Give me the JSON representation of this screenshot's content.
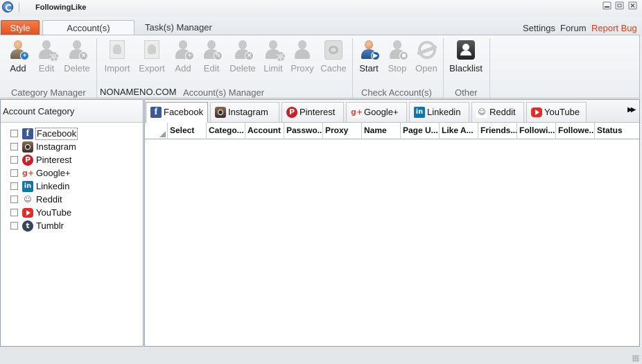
{
  "window": {
    "title": "FollowingLike",
    "controls": [
      "minimize",
      "maximize",
      "close"
    ]
  },
  "menu": {
    "style_tab": "Style",
    "tabs": [
      {
        "label": "Account(s) Manager",
        "active": true
      },
      {
        "label": "Task(s) Manager",
        "active": false
      }
    ],
    "links": {
      "settings": "Settings",
      "forum": "Forum",
      "report_bug": "Report Bug"
    },
    "report_bug_color": "#d8401b",
    "style_tab_color": "#e0501e"
  },
  "ribbon": {
    "category_manager": {
      "buttons": [
        {
          "label": "Add",
          "icon": "add-category-icon",
          "enabled": true
        },
        {
          "label": "Edit",
          "icon": "edit-category-icon",
          "enabled": false
        },
        {
          "label": "Delete",
          "icon": "delete-category-icon",
          "enabled": false
        }
      ],
      "group_label": "Category Manager"
    },
    "account_manager": {
      "buttons": [
        {
          "label": "Import",
          "icon": "import-icon",
          "enabled": false
        },
        {
          "label": "Export",
          "icon": "export-icon",
          "enabled": false
        },
        {
          "label": "Add",
          "icon": "add-account-icon",
          "enabled": false
        },
        {
          "label": "Edit",
          "icon": "edit-account-icon",
          "enabled": false
        },
        {
          "label": "Delete",
          "icon": "delete-account-icon",
          "enabled": false
        },
        {
          "label": "Limit",
          "icon": "limit-icon",
          "enabled": false
        },
        {
          "label": "Proxy",
          "icon": "proxy-icon",
          "enabled": false
        },
        {
          "label": "Cache",
          "icon": "cache-icon",
          "enabled": false
        }
      ],
      "watermark": "NONAMENO.COM",
      "group_label": "Account(s) Manager"
    },
    "check_accounts": {
      "buttons": [
        {
          "label": "Start",
          "icon": "start-check-icon",
          "enabled": true
        },
        {
          "label": "Stop",
          "icon": "stop-check-icon",
          "enabled": false
        },
        {
          "label": "Open",
          "icon": "browser-open-icon",
          "enabled": false
        }
      ],
      "group_label": "Check Account(s)"
    },
    "other": {
      "buttons": [
        {
          "label": "Blacklist",
          "icon": "blacklist-icon",
          "enabled": true
        }
      ],
      "group_label": "Other"
    }
  },
  "left_panel": {
    "header": "Account Category",
    "categories": [
      {
        "label": "Facebook",
        "icon": "facebook-icon",
        "checked": false,
        "selected": true
      },
      {
        "label": "Instagram",
        "icon": "instagram-icon",
        "checked": false,
        "selected": false
      },
      {
        "label": "Pinterest",
        "icon": "pinterest-icon",
        "checked": false,
        "selected": false
      },
      {
        "label": "Google+",
        "icon": "google-plus-icon",
        "checked": false,
        "selected": false
      },
      {
        "label": "Linkedin",
        "icon": "linkedin-icon",
        "checked": false,
        "selected": false
      },
      {
        "label": "Reddit",
        "icon": "reddit-icon",
        "checked": false,
        "selected": false
      },
      {
        "label": "YouTube",
        "icon": "youtube-icon",
        "checked": false,
        "selected": false
      },
      {
        "label": "Tumblr",
        "icon": "tumblr-icon",
        "checked": false,
        "selected": false
      }
    ]
  },
  "right_panel": {
    "tabs": [
      {
        "label": "Facebook",
        "icon": "facebook-icon",
        "active": true
      },
      {
        "label": "Instagram",
        "icon": "instagram-icon",
        "active": false
      },
      {
        "label": "Pinterest",
        "icon": "pinterest-icon",
        "active": false
      },
      {
        "label": "Google+",
        "icon": "google-plus-icon",
        "active": false
      },
      {
        "label": "Linkedin",
        "icon": "linkedin-icon",
        "active": false
      },
      {
        "label": "Reddit",
        "icon": "reddit-icon",
        "active": false
      },
      {
        "label": "YouTube",
        "icon": "youtube-icon",
        "active": false
      }
    ],
    "scroll_icon": "double-chevron-right-icon",
    "columns": [
      "Select",
      "Catego...",
      "Account",
      "Passwo...",
      "Proxy",
      "Name",
      "Page U...",
      "Like A...",
      "Friends...",
      "Followi...",
      "Followe...",
      "Status"
    ],
    "rows": []
  }
}
